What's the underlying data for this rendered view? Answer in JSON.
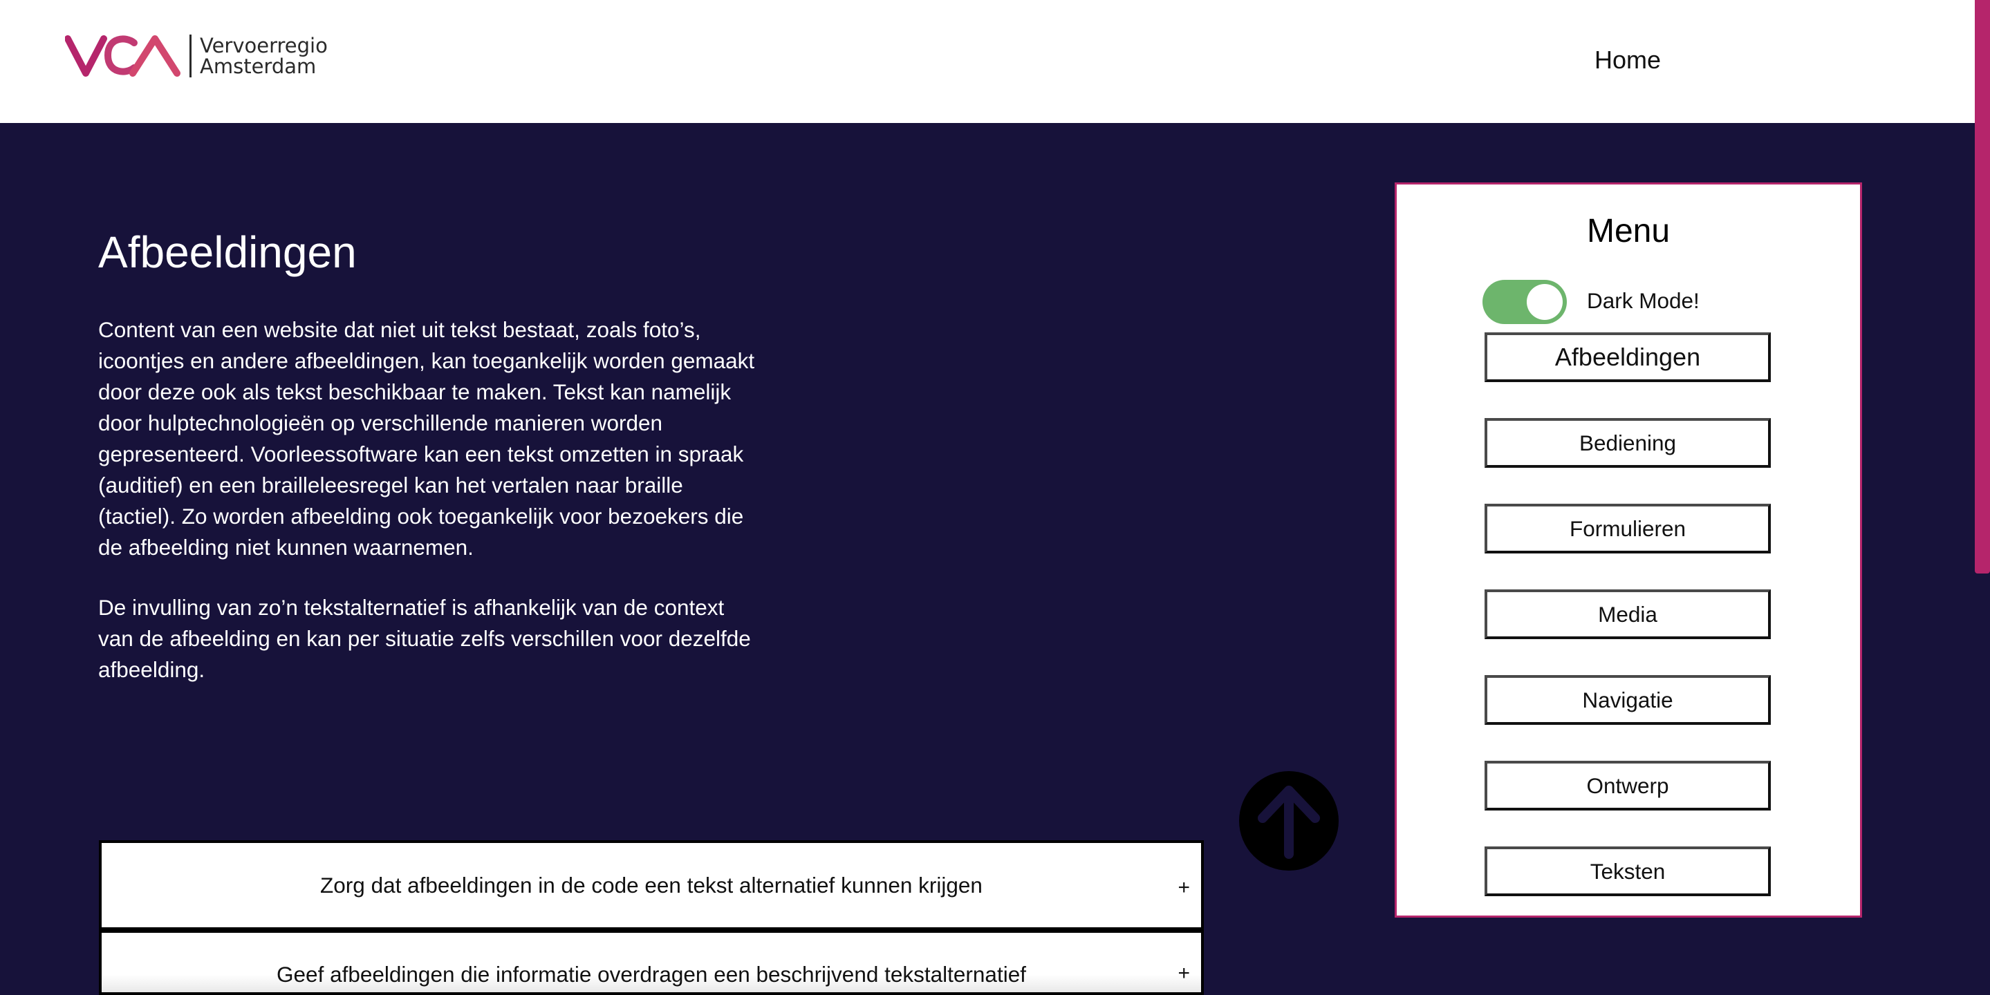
{
  "header": {
    "logo_line1": "Vervoerregio",
    "logo_line2": "Amsterdam",
    "nav_home": "Home"
  },
  "colors": {
    "background": "#17123a",
    "accent": "#b5256b",
    "toggle_on": "#6db56c"
  },
  "main": {
    "title": "Afbeeldingen",
    "paragraph1": "Content van een website dat niet uit tekst bestaat, zoals foto’s, icoontjes en andere afbeeldingen, kan toegankelijk worden gemaakt door deze ook als tekst beschikbaar te maken. Tekst kan namelijk door hulptechnologieën op verschillende manieren worden gepresenteerd. Voorleessoftware kan een tekst omzetten in spraak (auditief) en een brailleleesregel kan het vertalen naar braille (tactiel). Zo worden afbeelding ook toegankelijk voor bezoekers die de afbeelding niet kunnen waarnemen.",
    "paragraph2": "De invulling van zo’n tekstalternatief is afhankelijk van de context van de afbeelding en kan per situatie zelfs verschillen voor dezelfde afbeelding.",
    "accordion": [
      {
        "label": "Zorg dat afbeeldingen in de code een tekst alternatief kunnen krijgen",
        "toggle": "+"
      },
      {
        "label": "Geef afbeeldingen die informatie overdragen een beschrijvend tekstalternatief",
        "toggle": "+"
      }
    ],
    "scroll_top_icon": "arrow-up-icon"
  },
  "menu": {
    "title": "Menu",
    "dark_mode_label": "Dark Mode!",
    "dark_mode_on": true,
    "items": [
      {
        "label": "Afbeeldingen",
        "active": true
      },
      {
        "label": "Bediening"
      },
      {
        "label": "Formulieren"
      },
      {
        "label": "Media"
      },
      {
        "label": "Navigatie"
      },
      {
        "label": "Ontwerp"
      },
      {
        "label": "Teksten"
      }
    ]
  }
}
